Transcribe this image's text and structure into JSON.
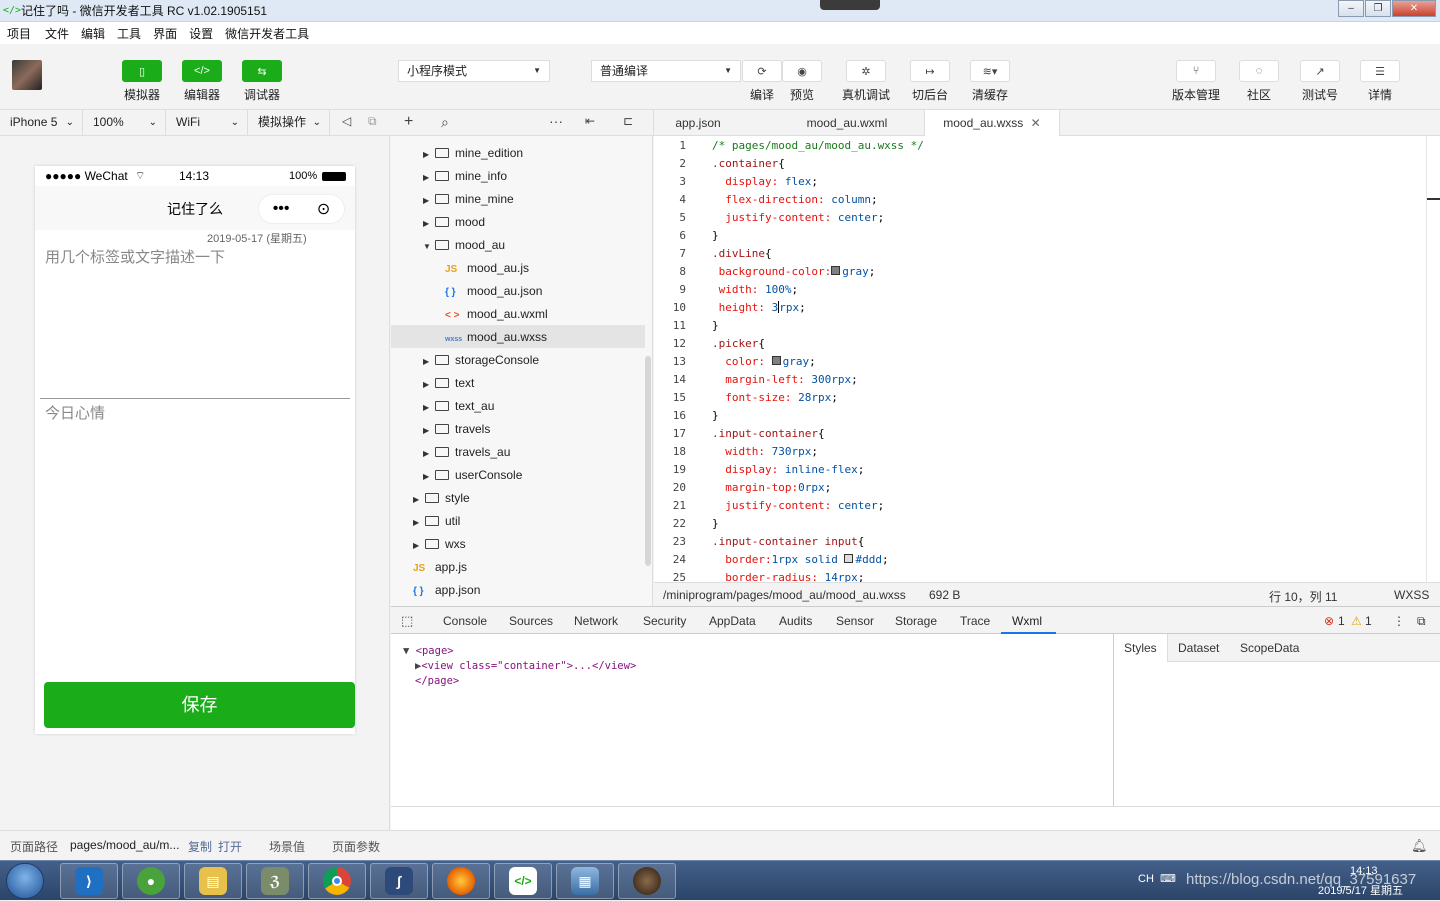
{
  "window": {
    "title": "记住了吗 - 微信开发者工具 RC v1.02.1905151"
  },
  "menu": [
    "项目",
    "文件",
    "编辑",
    "工具",
    "界面",
    "设置",
    "微信开发者工具"
  ],
  "toolbar": {
    "left": [
      {
        "label": "模拟器"
      },
      {
        "label": "编辑器"
      },
      {
        "label": "调试器"
      }
    ],
    "mode_select": "小程序模式",
    "compile_select": "普通编译",
    "actions": [
      {
        "label": "编译"
      },
      {
        "label": "预览"
      },
      {
        "label": "真机调试"
      },
      {
        "label": "切后台"
      },
      {
        "label": "清缓存"
      }
    ],
    "right": [
      {
        "label": "版本管理"
      },
      {
        "label": "社区"
      },
      {
        "label": "测试号"
      },
      {
        "label": "详情"
      }
    ]
  },
  "sim_bar": {
    "device": "iPhone 5",
    "zoom": "100%",
    "network": "WiFi",
    "ops": "模拟操作"
  },
  "phone": {
    "carrier": "●●●●● WeChat",
    "time": "14:13",
    "battery": "100%",
    "nav_title": "记住了么",
    "date": "2019-05-17 (星期五)",
    "placeholder_desc": "用几个标签或文字描述一下",
    "placeholder_mood": "今日心情",
    "save": "保存"
  },
  "bottom": {
    "path_label": "页面路径",
    "path": "pages/mood_au/m...",
    "copy": "复制",
    "open": "打开",
    "scene": "场景值",
    "params": "页面参数"
  },
  "filetree": [
    {
      "name": "mine_edition",
      "type": "folder",
      "depth": 1
    },
    {
      "name": "mine_info",
      "type": "folder",
      "depth": 1
    },
    {
      "name": "mine_mine",
      "type": "folder",
      "depth": 1
    },
    {
      "name": "mood",
      "type": "folder",
      "depth": 1
    },
    {
      "name": "mood_au",
      "type": "folder-open",
      "depth": 1
    },
    {
      "name": "mood_au.js",
      "type": "js",
      "depth": 2
    },
    {
      "name": "mood_au.json",
      "type": "json",
      "depth": 2
    },
    {
      "name": "mood_au.wxml",
      "type": "wxml",
      "depth": 2
    },
    {
      "name": "mood_au.wxss",
      "type": "wxss",
      "depth": 2
    },
    {
      "name": "storageConsole",
      "type": "folder",
      "depth": 1
    },
    {
      "name": "text",
      "type": "folder",
      "depth": 1
    },
    {
      "name": "text_au",
      "type": "folder",
      "depth": 1
    },
    {
      "name": "travels",
      "type": "folder",
      "depth": 1
    },
    {
      "name": "travels_au",
      "type": "folder",
      "depth": 1
    },
    {
      "name": "userConsole",
      "type": "folder",
      "depth": 1
    },
    {
      "name": "style",
      "type": "folder",
      "depth": 0
    },
    {
      "name": "util",
      "type": "folder",
      "depth": 0
    },
    {
      "name": "wxs",
      "type": "folder",
      "depth": 0
    },
    {
      "name": "app.js",
      "type": "js",
      "depth": 0
    },
    {
      "name": "app.json",
      "type": "json",
      "depth": 0
    }
  ],
  "tabs": [
    "app.json",
    "mood_au.wxml",
    "mood_au.wxss"
  ],
  "code_lines": [
    [
      [
        "c-com",
        "/* pages/mood_au/mood_au.wxss */"
      ]
    ],
    [
      [
        "c-sel",
        ".container"
      ],
      [
        "c-pun",
        "{"
      ]
    ],
    [
      [
        "c-prop",
        "  display: "
      ],
      [
        "c-val",
        "flex"
      ],
      [
        "c-pun",
        ";"
      ]
    ],
    [
      [
        "c-prop",
        "  flex-direction: "
      ],
      [
        "c-val",
        "column"
      ],
      [
        "c-pun",
        ";"
      ]
    ],
    [
      [
        "c-prop",
        "  justify-content: "
      ],
      [
        "c-val",
        "center"
      ],
      [
        "c-pun",
        ";"
      ]
    ],
    [
      [
        "c-pun",
        "}"
      ]
    ],
    [
      [
        "c-sel",
        ".divLine"
      ],
      [
        "c-pun",
        "{"
      ]
    ],
    [
      [
        "c-prop",
        " background-color:"
      ],
      [
        "sw",
        "gray"
      ],
      [
        "c-val",
        "gray"
      ],
      [
        "c-pun",
        ";"
      ]
    ],
    [
      [
        "c-prop",
        " width: "
      ],
      [
        "c-val",
        "100%"
      ],
      [
        "c-pun",
        ";"
      ]
    ],
    [
      [
        "c-prop",
        " height: "
      ],
      [
        "c-val",
        "3"
      ],
      [
        "cursor",
        ""
      ],
      [
        "c-val",
        "rpx"
      ],
      [
        "c-pun",
        ";"
      ]
    ],
    [
      [
        "c-pun",
        "}"
      ]
    ],
    [
      [
        "c-sel",
        ".picker"
      ],
      [
        "c-pun",
        "{"
      ]
    ],
    [
      [
        "c-prop",
        "  color: "
      ],
      [
        "sw",
        "gray"
      ],
      [
        "c-val",
        "gray"
      ],
      [
        "c-pun",
        ";"
      ]
    ],
    [
      [
        "c-prop",
        "  margin-left: "
      ],
      [
        "c-val",
        "300rpx"
      ],
      [
        "c-pun",
        ";"
      ]
    ],
    [
      [
        "c-prop",
        "  font-size: "
      ],
      [
        "c-val",
        "28rpx"
      ],
      [
        "c-pun",
        ";"
      ]
    ],
    [
      [
        "c-pun",
        "}"
      ]
    ],
    [
      [
        "c-sel",
        ".input-container"
      ],
      [
        "c-pun",
        "{"
      ]
    ],
    [
      [
        "c-prop",
        "  width: "
      ],
      [
        "c-val",
        "730rpx"
      ],
      [
        "c-pun",
        ";"
      ]
    ],
    [
      [
        "c-prop",
        "  display: "
      ],
      [
        "c-val",
        "inline-flex"
      ],
      [
        "c-pun",
        ";"
      ]
    ],
    [
      [
        "c-prop",
        "  margin-top:"
      ],
      [
        "c-val",
        "0rpx"
      ],
      [
        "c-pun",
        ";"
      ]
    ],
    [
      [
        "c-prop",
        "  justify-content: "
      ],
      [
        "c-val",
        "center"
      ],
      [
        "c-pun",
        ";"
      ]
    ],
    [
      [
        "c-pun",
        "}"
      ]
    ],
    [
      [
        "c-sel",
        ".input-container input"
      ],
      [
        "c-pun",
        "{"
      ]
    ],
    [
      [
        "c-prop",
        "  border:"
      ],
      [
        "c-val",
        "1rpx solid "
      ],
      [
        "sw",
        "#ddd"
      ],
      [
        "c-val",
        "#ddd"
      ],
      [
        "c-pun",
        ";"
      ]
    ],
    [
      [
        "c-prop",
        "  border-radius: "
      ],
      [
        "c-val",
        "14rpx"
      ],
      [
        "c-pun",
        ";"
      ]
    ]
  ],
  "editor_status": {
    "path": "/miniprogram/pages/mood_au/mood_au.wxss",
    "size": "692 B",
    "pos": "行 10，列 11",
    "lang": "WXSS"
  },
  "devtools": {
    "tabs": [
      "Console",
      "Sources",
      "Network",
      "Security",
      "AppData",
      "Audits",
      "Sensor",
      "Storage",
      "Trace",
      "Wxml"
    ],
    "errors": "1",
    "warnings": "1",
    "tree": [
      "<page>",
      "<view  class=\"container\">...</view>",
      "</page>"
    ],
    "side_tabs": [
      "Styles",
      "Dataset",
      "ScopeData"
    ]
  },
  "taskbar": {
    "time": "14:13",
    "date": "2019/5/17 星期五",
    "lang": "CH",
    "watermark": "https://blog.csdn.net/qq_37591637"
  },
  "colors": {
    "accent": "#1aad19",
    "devtab_active": "#1a73e8"
  }
}
